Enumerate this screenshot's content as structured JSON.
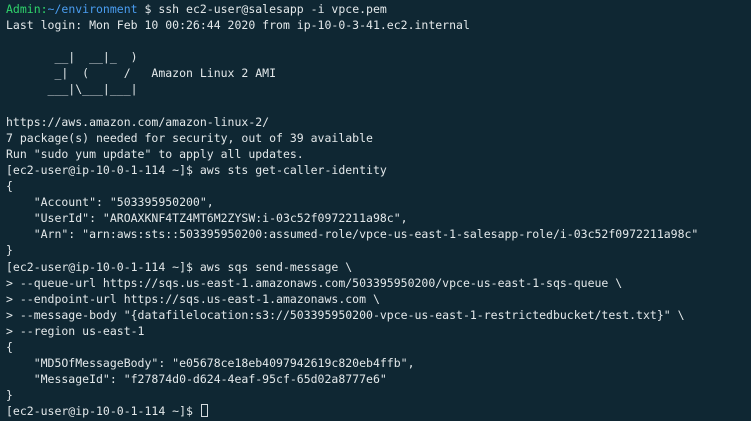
{
  "colors": {
    "background": "#0f2733",
    "text": "#e3e8ea",
    "prompt_user": "#2fd36b",
    "prompt_path": "#4a9df0"
  },
  "terminal": {
    "lines": [
      [
        {
          "t": "Admin:",
          "c": "green"
        },
        {
          "t": "~/environment",
          "c": "blue"
        },
        {
          "t": " $ ssh ec2-user@salesapp -i vpce.pem",
          "c": "default"
        }
      ],
      [
        {
          "t": "Last login: Mon Feb 10 00:26:44 2020 from ip-10-0-3-41.ec2.internal",
          "c": "default"
        }
      ],
      [
        {
          "t": "",
          "c": "default"
        }
      ],
      [
        {
          "t": "       __|  __|_  )",
          "c": "default"
        }
      ],
      [
        {
          "t": "       _|  (     /   Amazon Linux 2 AMI",
          "c": "default"
        }
      ],
      [
        {
          "t": "      ___|\\___|___|",
          "c": "default"
        }
      ],
      [
        {
          "t": "",
          "c": "default"
        }
      ],
      [
        {
          "t": "https://aws.amazon.com/amazon-linux-2/",
          "c": "default"
        }
      ],
      [
        {
          "t": "7 package(s) needed for security, out of 39 available",
          "c": "default"
        }
      ],
      [
        {
          "t": "Run \"sudo yum update\" to apply all updates.",
          "c": "default"
        }
      ],
      [
        {
          "t": "[ec2-user@ip-10-0-1-114 ~]$ aws sts get-caller-identity",
          "c": "default"
        }
      ],
      [
        {
          "t": "{",
          "c": "default"
        }
      ],
      [
        {
          "t": "    \"Account\": \"503395950200\",",
          "c": "default"
        }
      ],
      [
        {
          "t": "    \"UserId\": \"AROAXKNF4TZ4MT6M2ZYSW:i-03c52f0972211a98c\",",
          "c": "default"
        }
      ],
      [
        {
          "t": "    \"Arn\": \"arn:aws:sts::503395950200:assumed-role/vpce-us-east-1-salesapp-role/i-03c52f0972211a98c\"",
          "c": "default"
        }
      ],
      [
        {
          "t": "}",
          "c": "default"
        }
      ],
      [
        {
          "t": "[ec2-user@ip-10-0-1-114 ~]$ aws sqs send-message \\",
          "c": "default"
        }
      ],
      [
        {
          "t": "> --queue-url https://sqs.us-east-1.amazonaws.com/503395950200/vpce-us-east-1-sqs-queue \\",
          "c": "default"
        }
      ],
      [
        {
          "t": "> --endpoint-url https://sqs.us-east-1.amazonaws.com \\",
          "c": "default"
        }
      ],
      [
        {
          "t": "> --message-body \"{datafilelocation:s3://503395950200-vpce-us-east-1-restrictedbucket/test.txt}\" \\",
          "c": "default"
        }
      ],
      [
        {
          "t": "> --region us-east-1",
          "c": "default"
        }
      ],
      [
        {
          "t": "{",
          "c": "default"
        }
      ],
      [
        {
          "t": "    \"MD5OfMessageBody\": \"e05678ce18eb4097942619c820eb4ffb\",",
          "c": "default"
        }
      ],
      [
        {
          "t": "    \"MessageId\": \"f27874d0-d624-4eaf-95cf-65d02a8777e6\"",
          "c": "default"
        }
      ],
      [
        {
          "t": "}",
          "c": "default"
        }
      ],
      [
        {
          "t": "[ec2-user@ip-10-0-1-114 ~]$ ",
          "c": "default"
        }
      ]
    ]
  }
}
